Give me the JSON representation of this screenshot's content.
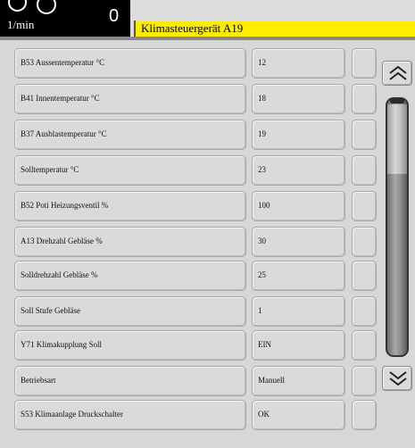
{
  "header": {
    "unit": "1/min",
    "rpm_value": "0",
    "title": "Klimasteuergerät A19"
  },
  "rows": [
    {
      "label": "B53 Aussentemperatur °C",
      "value": "12"
    },
    {
      "label": "B41 Innentemperatur °C",
      "value": "18"
    },
    {
      "label": "B37 Ausblastemperatur °C",
      "value": "19"
    },
    {
      "label": "Solltemperatur °C",
      "value": "23"
    },
    {
      "label": "B52 Poti Heizungsventil %",
      "value": "100"
    },
    {
      "label": "A13 Drehzahl Gebläse %",
      "value": "30"
    },
    {
      "label": "Solldrehzahl Gebläse %",
      "value": "25"
    },
    {
      "label": "Soll Stufe Gebläse",
      "value": "1"
    },
    {
      "label": "Y71 Klimakupplung Soll",
      "value": "EIN"
    },
    {
      "label": "Betriebsart",
      "value": "Manuell"
    },
    {
      "label": "S53 Klimaanlage Druckschalter",
      "value": "OK"
    }
  ],
  "icons": {
    "scroll_up": "double-chevron-up-icon",
    "scroll_down": "double-chevron-down-icon"
  },
  "colors": {
    "title_highlight": "#ffed00",
    "header_bg": "#000000",
    "panel_bg": "#d7d7d7"
  }
}
